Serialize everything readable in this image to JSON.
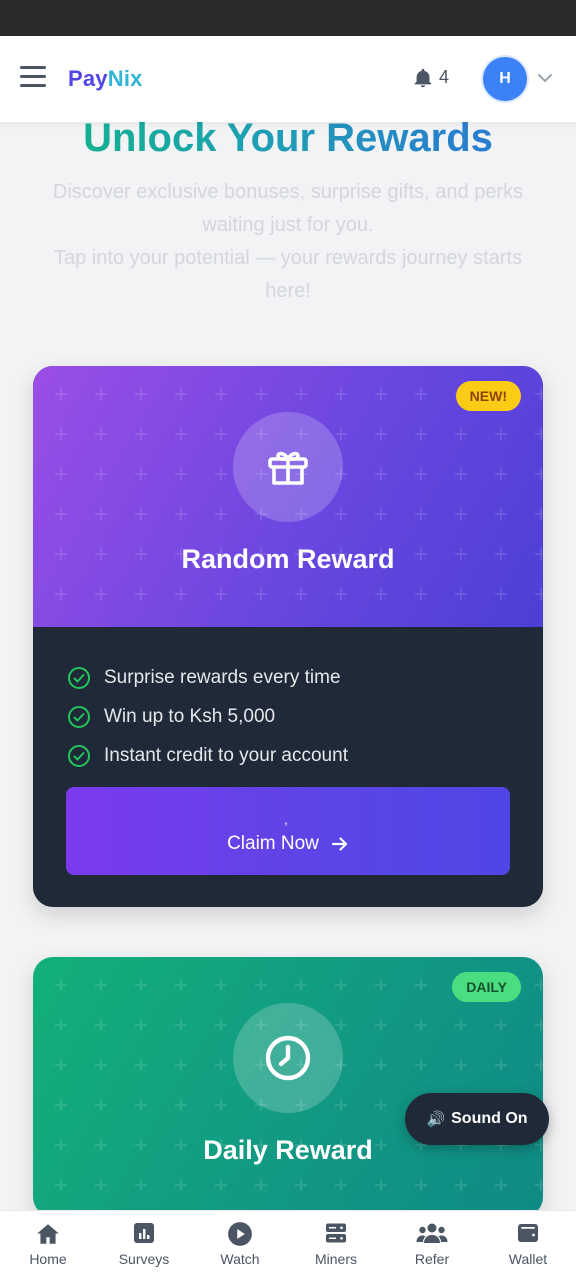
{
  "app": {
    "logo_part1": "Pay",
    "logo_part2": "Nix",
    "brand_color": "#4f46e5",
    "accent_color": "#2fb5d8"
  },
  "header": {
    "menu_icon": "hamburger-icon",
    "notification_icon": "bell-icon",
    "notification_count": "4",
    "avatar_initial": "H",
    "avatar_color": "#3b82f6",
    "dropdown_icon": "chevron-down-icon"
  },
  "hero": {
    "title": "Unlock Your Rewards",
    "subtitle_line1": "Discover exclusive bonuses, surprise gifts, and perks waiting just for you.",
    "subtitle_line2": "Tap into your potential — your rewards journey starts here!"
  },
  "cards": [
    {
      "badge": "NEW!",
      "icon": "gift-icon",
      "title": "Random Reward",
      "features": [
        "Surprise rewards every time",
        "Win up to Ksh 5,000",
        "Instant credit to your account"
      ],
      "button_prefix": ",",
      "button_label": "Claim Now",
      "button_icon": "arrow-right-icon",
      "gradient_colors": [
        "#9b4ee6",
        "#4c3fd6"
      ]
    },
    {
      "badge": "DAILY",
      "icon": "clock-icon",
      "title": "Daily Reward",
      "gradient_colors": [
        "#12b07a",
        "#0f8a84"
      ]
    }
  ],
  "sound_toggle": {
    "icon": "speaker-icon",
    "glyph": "🔊",
    "label": "Sound On"
  },
  "bottom_nav": [
    {
      "label": "Home",
      "icon": "home-icon"
    },
    {
      "label": "Surveys",
      "icon": "bar-chart-icon"
    },
    {
      "label": "Watch",
      "icon": "play-circle-icon"
    },
    {
      "label": "Miners",
      "icon": "server-icon"
    },
    {
      "label": "Refer",
      "icon": "users-icon"
    },
    {
      "label": "Wallet",
      "icon": "wallet-icon"
    }
  ]
}
